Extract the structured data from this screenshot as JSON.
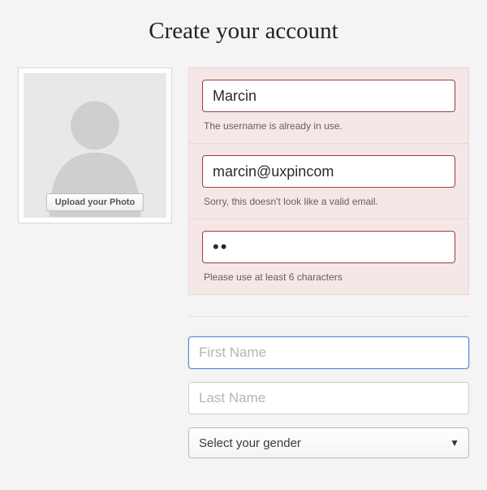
{
  "title": "Create your account",
  "photo": {
    "upload_label": "Upload your Photo"
  },
  "fields": {
    "username": {
      "value": "Marcin",
      "error": "The username is already in use."
    },
    "email": {
      "value": "marcin@uxpincom",
      "error": "Sorry, this doesn't look like a valid email."
    },
    "password": {
      "value": "••",
      "error": "Please use at least 6 characters"
    },
    "first_name": {
      "value": "",
      "placeholder": "First Name"
    },
    "last_name": {
      "value": "",
      "placeholder": "Last Name"
    },
    "gender": {
      "selected": "Select your gender"
    }
  }
}
